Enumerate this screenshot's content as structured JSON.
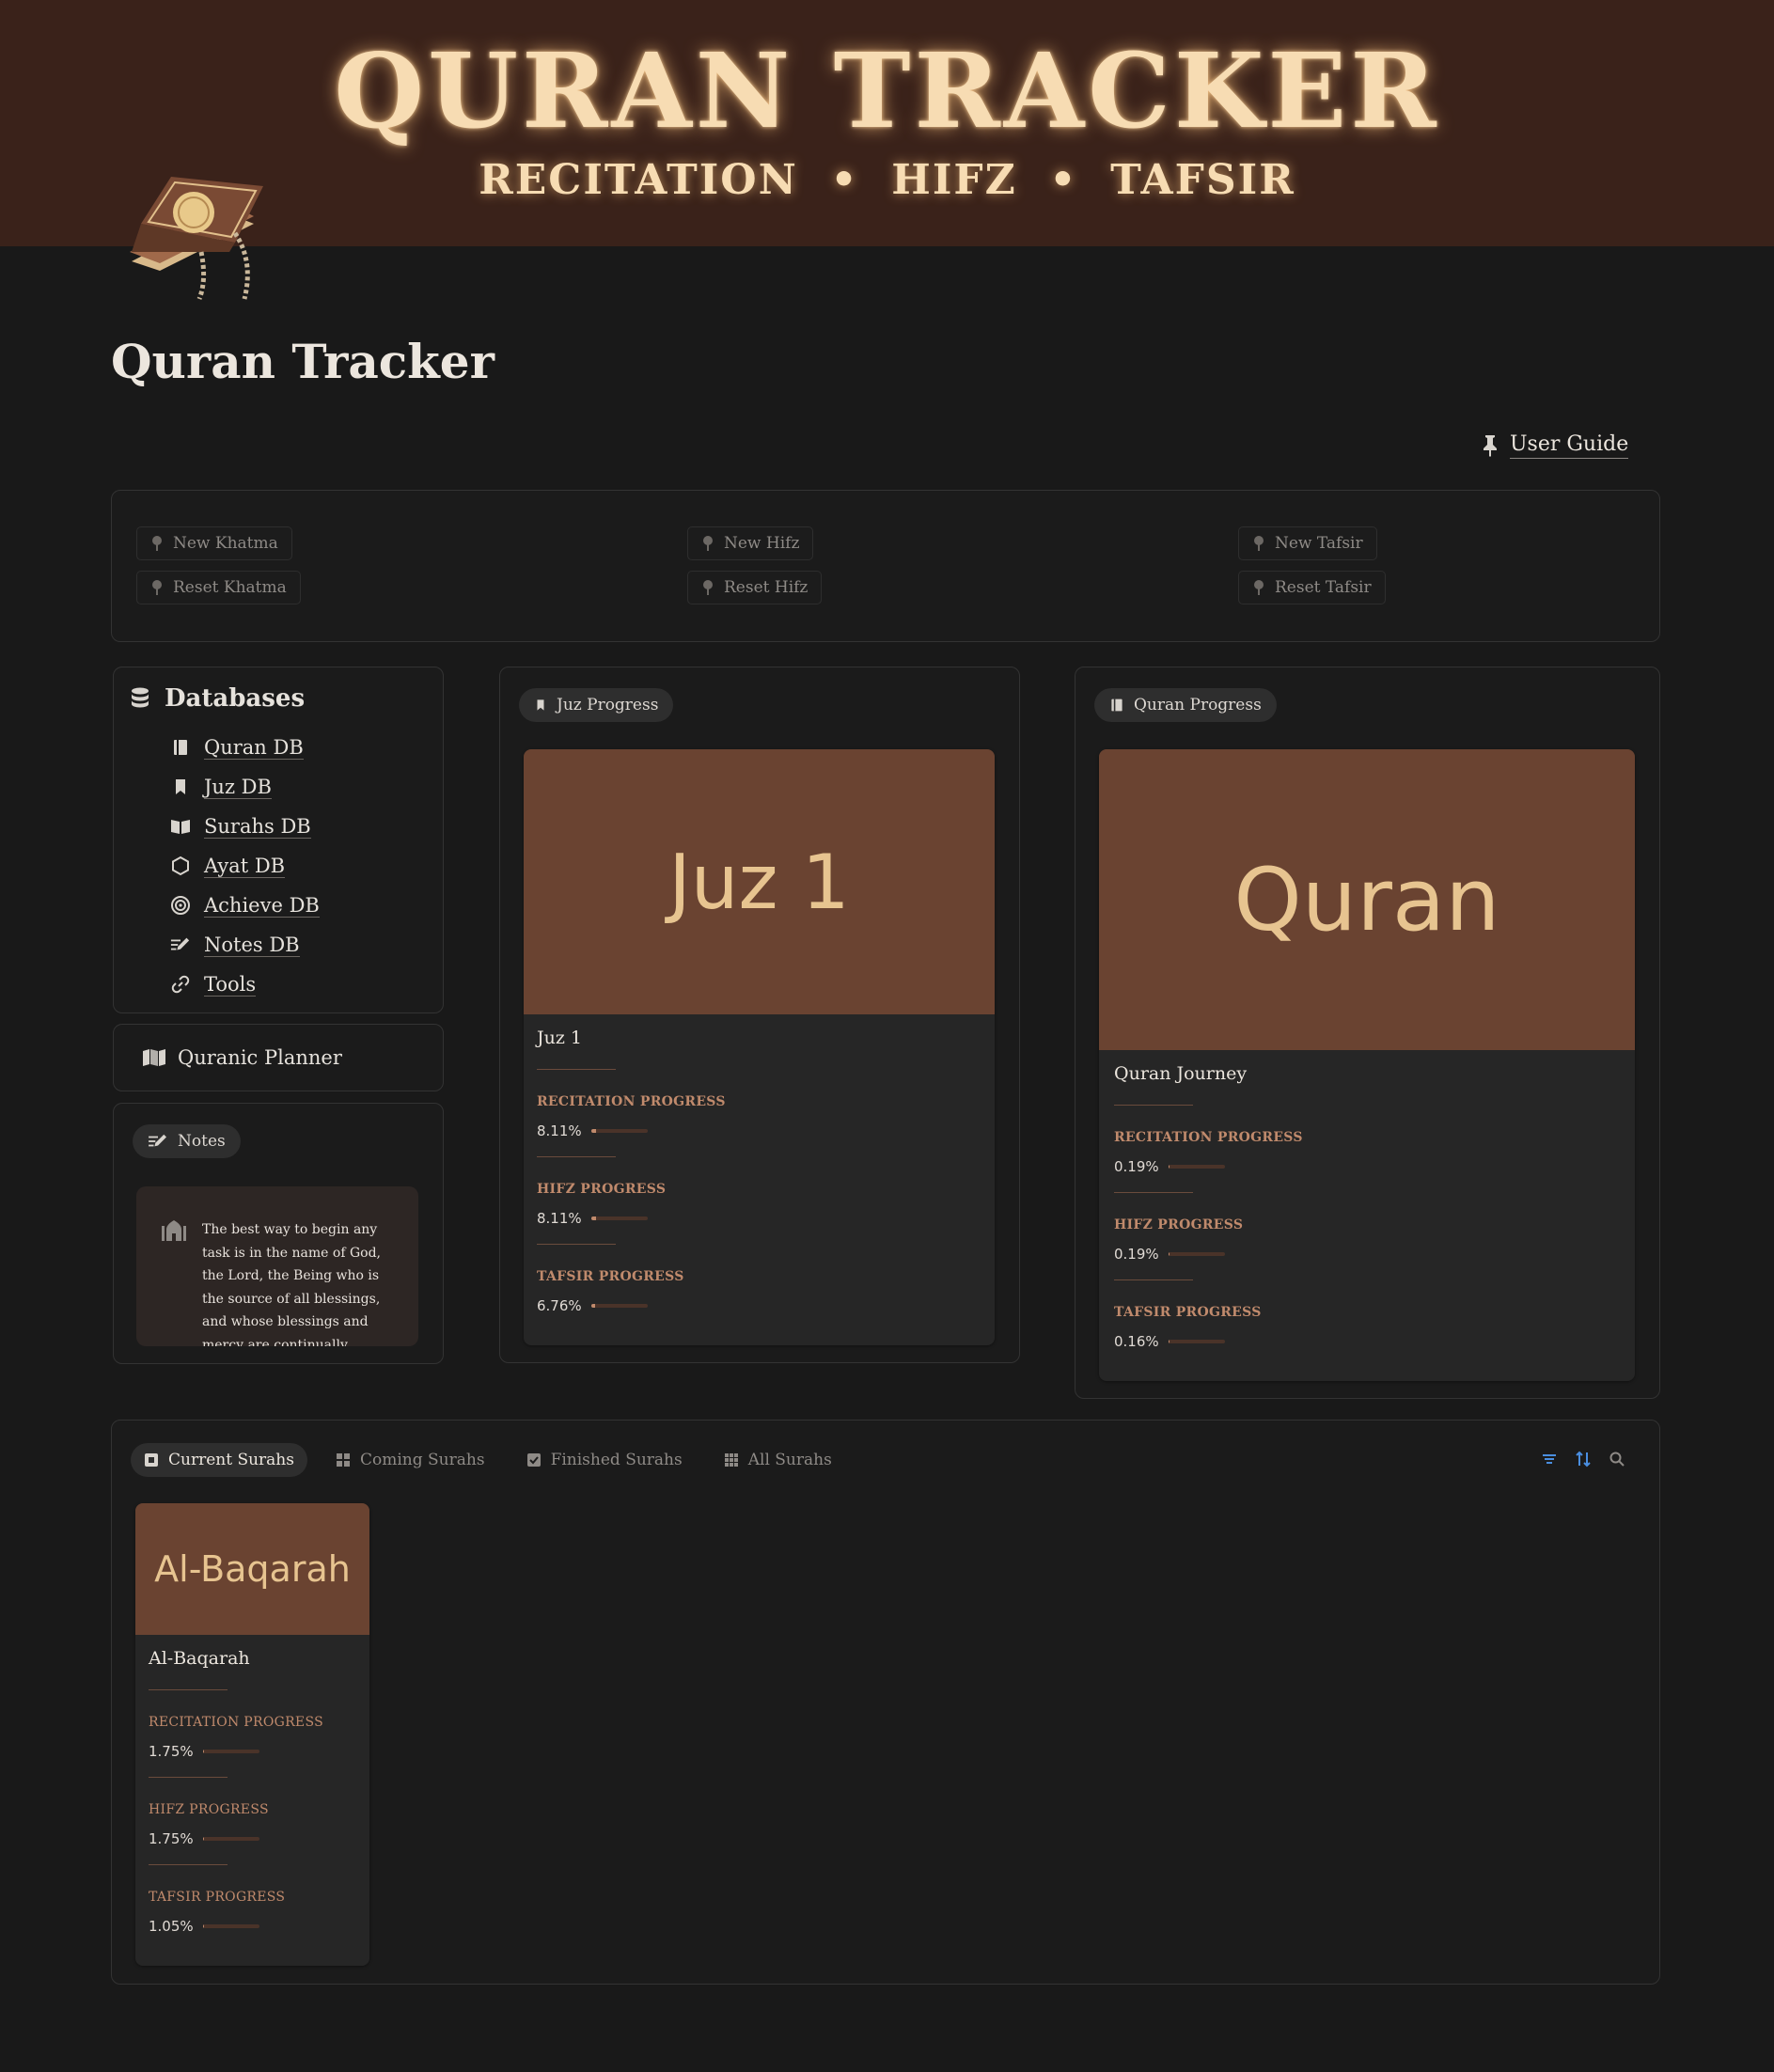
{
  "banner": {
    "title": "QURAN TRACKER",
    "subtitle": "RECITATION  •  HIFZ  •  TAFSIR"
  },
  "page": {
    "title": "Quran Tracker",
    "user_guide": "User Guide"
  },
  "buttons": {
    "khatma": [
      "New Khatma",
      "Reset Khatma"
    ],
    "hifz": [
      "New Hifz",
      "Reset Hifz"
    ],
    "tafsir": [
      "New Tafsir",
      "Reset Tafsir"
    ]
  },
  "databases": {
    "heading": "Databases",
    "items": [
      {
        "label": "Quran DB",
        "icon": "book-icon"
      },
      {
        "label": "Juz DB",
        "icon": "bookmark-icon"
      },
      {
        "label": "Surahs DB",
        "icon": "open-book-icon"
      },
      {
        "label": "Ayat DB",
        "icon": "hexagon-icon"
      },
      {
        "label": "Achieve DB",
        "icon": "target-icon"
      },
      {
        "label": "Notes DB",
        "icon": "edit-list-icon"
      },
      {
        "label": "Tools",
        "icon": "link-icon"
      }
    ]
  },
  "planner": {
    "label": "Quranic Planner"
  },
  "notes": {
    "label": "Notes",
    "quote": "The best way to begin any task is in the name of God, the Lord, the Being who is the source of all blessings, and whose blessings and mercy are continually"
  },
  "juz_progress": {
    "pill": "Juz Progress",
    "card": {
      "cover": "Juz 1",
      "name": "Juz 1",
      "recitation_label": "RECITATION PROGRESS",
      "recitation": "8.11%",
      "recitation_value": 0.0811,
      "hifz_label": "HIFZ PROGRESS",
      "hifz": "8.11%",
      "hifz_value": 0.0811,
      "tafsir_label": "TAFSIR PROGRESS",
      "tafsir": "6.76%",
      "tafsir_value": 0.0676
    }
  },
  "quran_progress": {
    "pill": "Quran Progress",
    "card": {
      "cover": "Quran",
      "name": "Quran Journey",
      "recitation_label": "RECITATION PROGRESS",
      "recitation": "0.19%",
      "recitation_value": 0.0019,
      "hifz_label": "HIFZ PROGRESS",
      "hifz": "0.19%",
      "hifz_value": 0.0019,
      "tafsir_label": "TAFSIR PROGRESS",
      "tafsir": "0.16%",
      "tafsir_value": 0.0016
    }
  },
  "surahs": {
    "tabs": [
      "Current Surahs",
      "Coming Surahs",
      "Finished Surahs",
      "All Surahs"
    ],
    "card": {
      "cover": "Al-Baqarah",
      "name": "Al-Baqarah",
      "recitation_label": "RECITATION PROGRESS",
      "recitation": "1.75%",
      "recitation_value": 0.0175,
      "hifz_label": "HIFZ PROGRESS",
      "hifz": "1.75%",
      "hifz_value": 0.0175,
      "tafsir_label": "TAFSIR PROGRESS",
      "tafsir": "1.05%",
      "tafsir_value": 0.0105
    }
  },
  "colors": {
    "background": "#191919",
    "banner": "#3a221a",
    "cover": "#6a4331",
    "accent": "#c08a6c",
    "tool_blue": "#4a8ee0"
  }
}
